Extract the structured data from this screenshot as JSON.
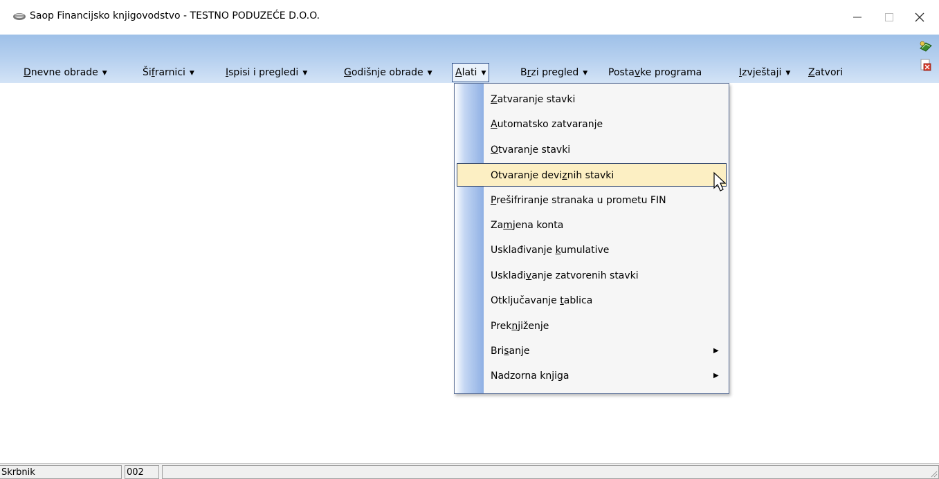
{
  "window": {
    "title": "Saop Financijsko knjigovodstvo - TESTNO PODUZEĆE D.O.O.",
    "app_icon": "book-icon",
    "controls": {
      "minimize": "—",
      "maximize": "□",
      "close": "✕"
    }
  },
  "menubar": {
    "items": [
      {
        "pre": "",
        "u": "D",
        "post": "nevne obrade",
        "dropdown": true
      },
      {
        "pre": "Ši",
        "u": "f",
        "post": "rarnici",
        "dropdown": true
      },
      {
        "pre": "",
        "u": "I",
        "post": "spisi i pregledi",
        "dropdown": true
      },
      {
        "pre": "",
        "u": "G",
        "post": "odišnje obrade",
        "dropdown": true
      },
      {
        "pre": "",
        "u": "A",
        "post": "lati",
        "dropdown": true,
        "active": true
      },
      {
        "pre": "B",
        "u": "r",
        "post": "zi pregled",
        "dropdown": true
      },
      {
        "pre": "Posta",
        "u": "v",
        "post": "ke programa",
        "dropdown": false
      },
      {
        "pre": "",
        "u": "I",
        "post": "zvještaji",
        "dropdown": true
      },
      {
        "pre": "",
        "u": "Z",
        "post": "atvori",
        "dropdown": false
      }
    ],
    "right_icons": [
      "help-book-icon",
      "exit-document-icon"
    ]
  },
  "alati_menu": {
    "items": [
      {
        "pre": "",
        "u": "Z",
        "post": "atvaranje stavki",
        "submenu": false
      },
      {
        "pre": "",
        "u": "A",
        "post": "utomatsko zatvaranje",
        "submenu": false
      },
      {
        "pre": "",
        "u": "O",
        "post": "tvaranje stavki",
        "submenu": false
      },
      {
        "pre": "Otvaranje devi",
        "u": "z",
        "post": "nih stavki",
        "submenu": false,
        "highlighted": true
      },
      {
        "pre": "",
        "u": "P",
        "post": "rešifriranje stranaka u prometu FIN",
        "submenu": false
      },
      {
        "pre": "Za",
        "u": "m",
        "post": "jena konta",
        "submenu": false
      },
      {
        "pre": "Usklađivanje ",
        "u": "k",
        "post": "umulative",
        "submenu": false
      },
      {
        "pre": "Usklađi",
        "u": "v",
        "post": "anje zatvorenih stavki",
        "submenu": false
      },
      {
        "pre": "Otključavanje ",
        "u": "t",
        "post": "ablica",
        "submenu": false
      },
      {
        "pre": "Prek",
        "u": "n",
        "post": "jiženje",
        "submenu": false
      },
      {
        "pre": "Bri",
        "u": "s",
        "post": "anje",
        "submenu": true
      },
      {
        "pre": "Nadzorna knjiga",
        "u": "",
        "post": "",
        "submenu": true
      }
    ],
    "submenu_arrow": "▶"
  },
  "statusbar": {
    "user": "Skrbnik",
    "code": "002",
    "rest": ""
  }
}
